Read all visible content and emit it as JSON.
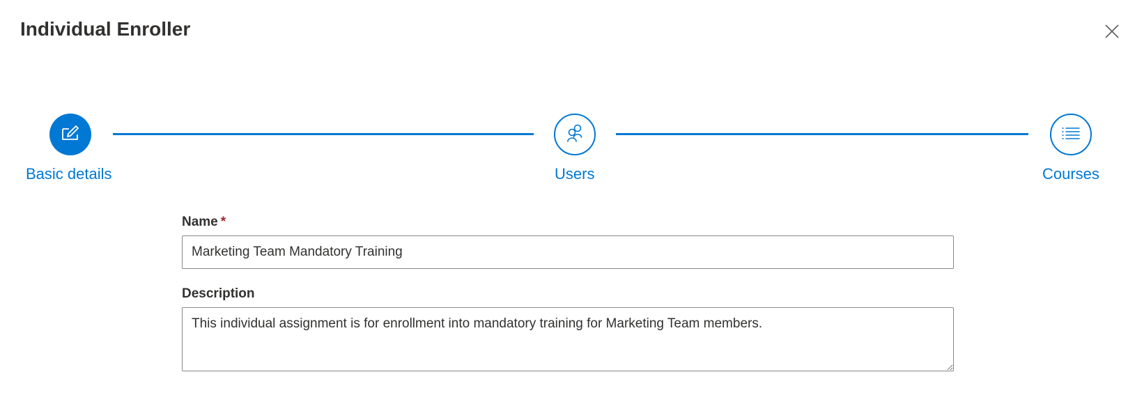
{
  "dialog": {
    "title": "Individual Enroller"
  },
  "stepper": {
    "steps": [
      {
        "label": "Basic details",
        "icon": "edit-icon",
        "state": "active"
      },
      {
        "label": "Users",
        "icon": "people-icon",
        "state": "inactive"
      },
      {
        "label": "Courses",
        "icon": "list-icon",
        "state": "inactive"
      }
    ]
  },
  "form": {
    "name": {
      "label": "Name",
      "required_marker": "*",
      "value": "Marketing Team Mandatory Training"
    },
    "description": {
      "label": "Description",
      "value": "This individual assignment is for enrollment into mandatory training for Marketing Team members."
    }
  },
  "colors": {
    "accent": "#0078d4",
    "required": "#a4262c",
    "text": "#323130",
    "border": "#8a8886"
  }
}
